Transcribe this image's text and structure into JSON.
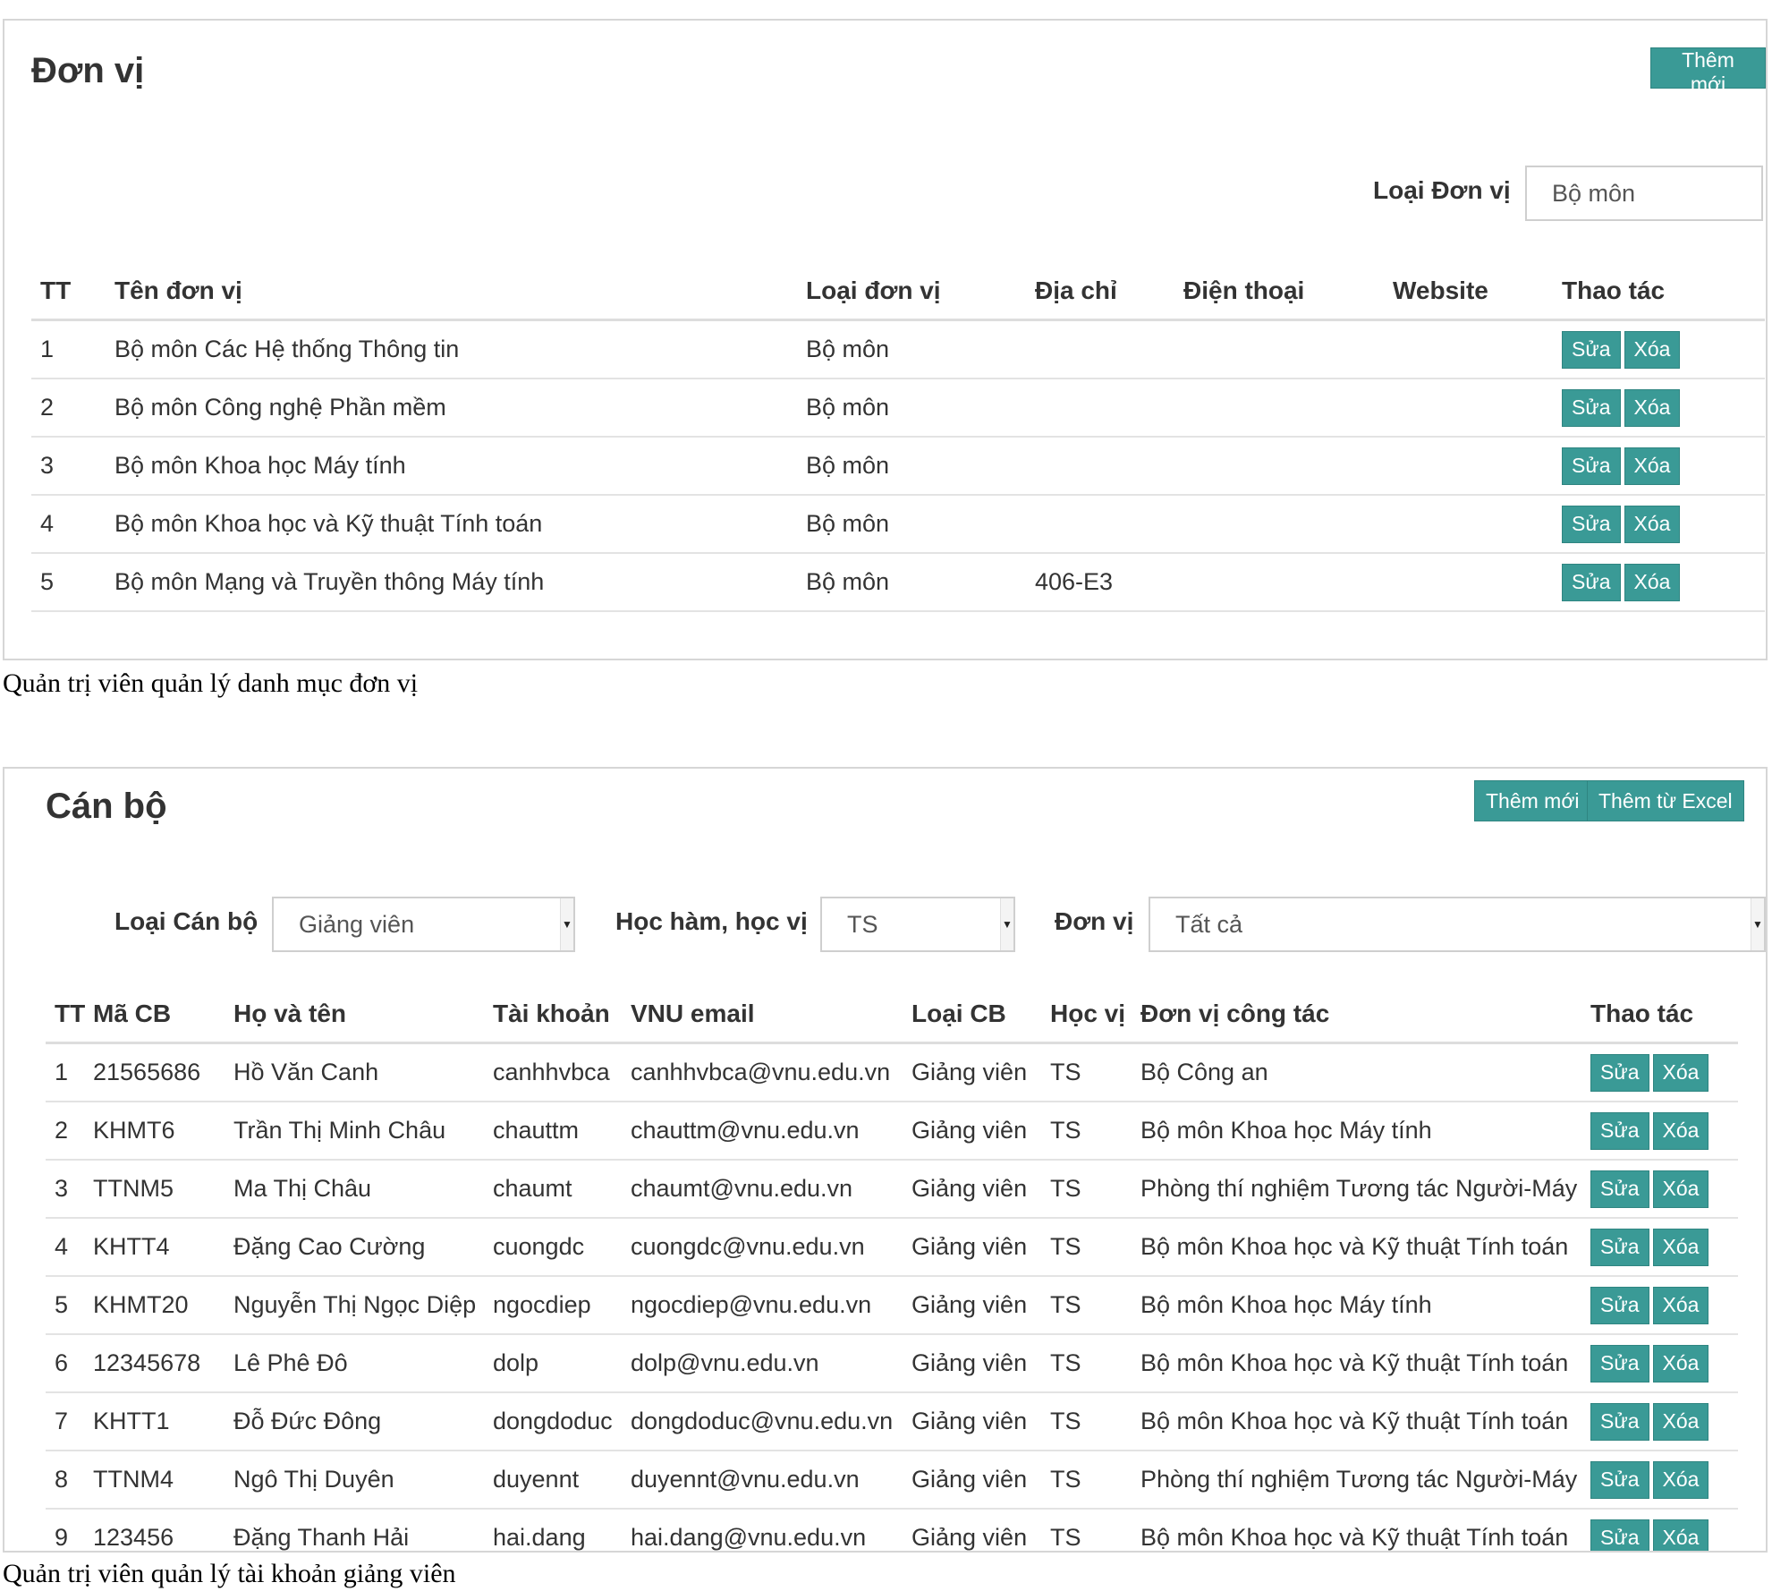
{
  "donvi": {
    "title": "Đơn vị",
    "add_button": "Thêm mới",
    "filter": {
      "label": "Loại Đơn vị",
      "value": "Bộ môn"
    },
    "columns": [
      "TT",
      "Tên đơn vị",
      "Loại đơn vị",
      "Địa chỉ",
      "Điện thoại",
      "Website",
      "Thao tác"
    ],
    "rows": [
      {
        "tt": "1",
        "ten": "Bộ môn Các Hệ thống Thông tin",
        "loai": "Bộ môn",
        "diachi": "",
        "dienthoai": "",
        "website": ""
      },
      {
        "tt": "2",
        "ten": "Bộ môn Công nghệ Phần mềm",
        "loai": "Bộ môn",
        "diachi": "",
        "dienthoai": "",
        "website": ""
      },
      {
        "tt": "3",
        "ten": "Bộ môn Khoa học Máy tính",
        "loai": "Bộ môn",
        "diachi": "",
        "dienthoai": "",
        "website": ""
      },
      {
        "tt": "4",
        "ten": "Bộ môn Khoa học và Kỹ thuật Tính toán",
        "loai": "Bộ môn",
        "diachi": "",
        "dienthoai": "",
        "website": ""
      },
      {
        "tt": "5",
        "ten": "Bộ môn Mạng và Truyền thông Máy tính",
        "loai": "Bộ môn",
        "diachi": "406-E3",
        "dienthoai": "",
        "website": ""
      }
    ],
    "edit_label": "Sửa",
    "delete_label": "Xóa"
  },
  "caption1": "Quản trị viên quản lý danh mục đơn vị",
  "canbo": {
    "title": "Cán bộ",
    "add_button": "Thêm mới",
    "excel_button": "Thêm từ Excel",
    "filters": {
      "loai_label": "Loại Cán bộ",
      "loai_value": "Giảng viên",
      "hocham_label": "Học hàm, học vị",
      "hocham_value": "TS",
      "donvi_label": "Đơn vị",
      "donvi_value": "Tất cả"
    },
    "columns": [
      "TT",
      "Mã CB",
      "Họ và tên",
      "Tài khoản",
      "VNU email",
      "Loại CB",
      "Học vị",
      "Đơn vị công tác",
      "Thao tác"
    ],
    "rows": [
      {
        "tt": "1",
        "ma": "21565686",
        "ten": "Hồ Văn Canh",
        "tk": "canhhvbca",
        "email": "canhhvbca@vnu.edu.vn",
        "loai": "Giảng viên",
        "hocvi": "TS",
        "donvi": "Bộ Công an"
      },
      {
        "tt": "2",
        "ma": "KHMT6",
        "ten": "Trần Thị Minh Châu",
        "tk": "chauttm",
        "email": "chauttm@vnu.edu.vn",
        "loai": "Giảng viên",
        "hocvi": "TS",
        "donvi": "Bộ môn Khoa học Máy tính"
      },
      {
        "tt": "3",
        "ma": "TTNM5",
        "ten": "Ma Thị Châu",
        "tk": "chaumt",
        "email": "chaumt@vnu.edu.vn",
        "loai": "Giảng viên",
        "hocvi": "TS",
        "donvi": "Phòng thí nghiệm Tương tác Người-Máy"
      },
      {
        "tt": "4",
        "ma": "KHTT4",
        "ten": "Đặng Cao Cường",
        "tk": "cuongdc",
        "email": "cuongdc@vnu.edu.vn",
        "loai": "Giảng viên",
        "hocvi": "TS",
        "donvi": "Bộ môn Khoa học và Kỹ thuật Tính toán"
      },
      {
        "tt": "5",
        "ma": "KHMT20",
        "ten": "Nguyễn Thị Ngọc Diệp",
        "tk": "ngocdiep",
        "email": "ngocdiep@vnu.edu.vn",
        "loai": "Giảng viên",
        "hocvi": "TS",
        "donvi": "Bộ môn Khoa học Máy tính"
      },
      {
        "tt": "6",
        "ma": "12345678",
        "ten": "Lê Phê Đô",
        "tk": "dolp",
        "email": "dolp@vnu.edu.vn",
        "loai": "Giảng viên",
        "hocvi": "TS",
        "donvi": "Bộ môn Khoa học và Kỹ thuật Tính toán"
      },
      {
        "tt": "7",
        "ma": "KHTT1",
        "ten": "Đỗ Đức Đông",
        "tk": "dongdoduc",
        "email": "dongdoduc@vnu.edu.vn",
        "loai": "Giảng viên",
        "hocvi": "TS",
        "donvi": "Bộ môn Khoa học và Kỹ thuật Tính toán"
      },
      {
        "tt": "8",
        "ma": "TTNM4",
        "ten": "Ngô Thị Duyên",
        "tk": "duyennt",
        "email": "duyennt@vnu.edu.vn",
        "loai": "Giảng viên",
        "hocvi": "TS",
        "donvi": "Phòng thí nghiệm Tương tác Người-Máy"
      },
      {
        "tt": "9",
        "ma": "123456",
        "ten": "Đặng Thanh Hải",
        "tk": "hai.dang",
        "email": "hai.dang@vnu.edu.vn",
        "loai": "Giảng viên",
        "hocvi": "TS",
        "donvi": "Bộ môn Khoa học và Kỹ thuật Tính toán"
      }
    ],
    "edit_label": "Sửa",
    "delete_label": "Xóa"
  },
  "caption2": "Quản trị viên quản lý tài khoản giảng viên",
  "colors": {
    "accent": "#3a9a96",
    "border": "#d6d6d6"
  }
}
